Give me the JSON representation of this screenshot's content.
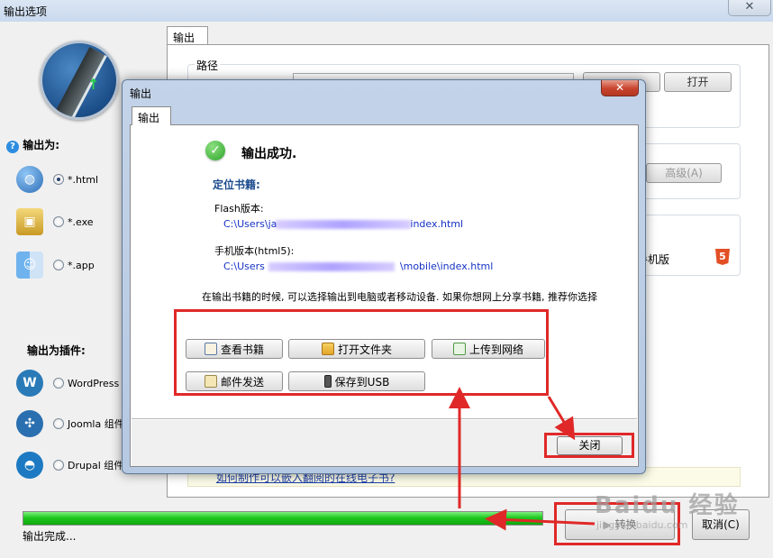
{
  "window": {
    "title": "输出选项",
    "close_glyph": "✕"
  },
  "sidebar": {
    "output_as_label": "输出为:",
    "formats": [
      {
        "label": "*.html",
        "icon": "globe-icon",
        "selected": true
      },
      {
        "label": "*.exe",
        "icon": "lock-package-icon",
        "selected": false
      },
      {
        "label": "*.app",
        "icon": "mac-finder-icon",
        "selected": false
      }
    ],
    "plugins_label": "输出为插件:",
    "plugins": [
      {
        "label": "WordPress 插",
        "icon": "wordpress-icon",
        "selected": false
      },
      {
        "label": "Joomla 组件",
        "icon": "joomla-icon",
        "selected": false
      },
      {
        "label": "Drupal 组件",
        "icon": "drupal-icon",
        "selected": false
      }
    ]
  },
  "main": {
    "tab_label": "输出",
    "path_group_title": "路径",
    "open_button": "打开",
    "advanced_button": "高级(A)",
    "mobile_text": "手机版",
    "help_link": "如何制作可以嵌入翻阅的在线电子书?"
  },
  "footer": {
    "progress_percent": 100,
    "status": "输出完成...",
    "convert_button": "转换",
    "cancel_button": "取消(C)"
  },
  "dialog": {
    "title": "输出",
    "close_glyph": "✕",
    "tab_label": "输出",
    "success_message": "输出成功.",
    "locate_heading": "定位书籍:",
    "flash_label": "Flash版本:",
    "flash_path_prefix": "C:\\Users\\ja",
    "flash_path_suffix": "index.html",
    "mobile_label": "手机版本(html5):",
    "mobile_path_prefix": "C:\\Users",
    "mobile_path_suffix": "\\mobile\\index.html",
    "hint": "在输出书籍的时候, 可以选择输出到电脑或者移动设备. 如果你想网上分享书籍, 推荐你选择",
    "buttons": {
      "view_book": "查看书籍",
      "open_folder": "打开文件夹",
      "upload_web": "上传到网络",
      "send_email": "邮件发送",
      "save_usb": "保存到USB"
    },
    "close_button": "关闭"
  },
  "colors": {
    "annotation_red": "#e02828",
    "progress_green": "#1fc81f",
    "link_blue": "#1532c4",
    "heading_blue": "#1a4a8c"
  },
  "watermark": {
    "text": "Baidu 经验",
    "sub": "jingyan.baidu.com"
  }
}
